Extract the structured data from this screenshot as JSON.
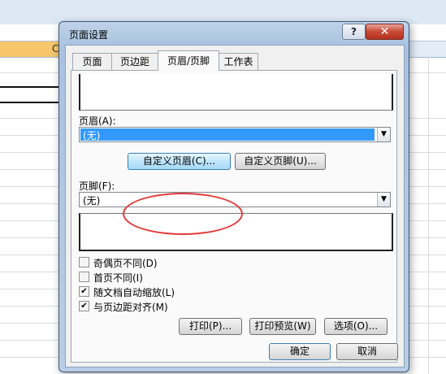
{
  "sheet": {
    "column_letter": "C"
  },
  "dialog": {
    "title": "页面设置",
    "help_label": "?",
    "close_label": "✕",
    "tabs": [
      {
        "label": "页面"
      },
      {
        "label": "页边距"
      },
      {
        "label": "页眉/页脚"
      },
      {
        "label": "工作表"
      }
    ],
    "header_label": "页眉(A):",
    "header_value": "(无)",
    "custom_header_label": "自定义页眉(C)...",
    "custom_footer_label": "自定义页脚(U)...",
    "footer_label": "页脚(F):",
    "footer_value": "(无)",
    "checkboxes": [
      {
        "label": "奇偶页不同(D)",
        "checked": false
      },
      {
        "label": "首页不同(I)",
        "checked": false
      },
      {
        "label": "随文档自动缩放(L)",
        "checked": true
      },
      {
        "label": "与页边距对齐(M)",
        "checked": true
      }
    ],
    "print_label": "打印(P)...",
    "print_preview_label": "打印预览(W)",
    "options_label": "选项(O)...",
    "ok_label": "确定",
    "cancel_label": "取消"
  },
  "colors": {
    "highlight": "#3399ff",
    "annotation": "#e3393a",
    "titlebar": "#bed3ea"
  }
}
